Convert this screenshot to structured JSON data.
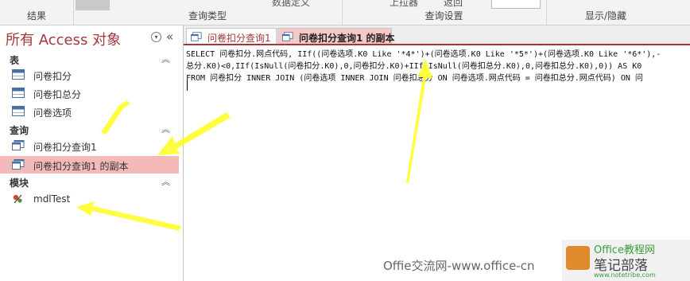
{
  "ribbon": {
    "groups": [
      "结果",
      "查询类型",
      "查询设置",
      "显示/隐藏"
    ],
    "cut_labels": [
      "数据定义",
      "上拉器",
      "返回"
    ]
  },
  "nav": {
    "title": "所有 Access 对象",
    "collapse": "«",
    "sections": [
      {
        "label": "表",
        "items": [
          "问卷扣分",
          "问卷扣总分",
          "问卷选项"
        ]
      },
      {
        "label": "查询",
        "items": [
          "问卷扣分查询1",
          "问卷扣分查询1 的副本"
        ]
      },
      {
        "label": "模块",
        "items": [
          "mdlTest"
        ]
      }
    ],
    "selected": "问卷扣分查询1 的副本"
  },
  "tabs": [
    "问卷扣分查询1",
    "问卷扣分查询1 的副本"
  ],
  "sql_lines": [
    "SELECT 问卷扣分.网点代码, IIf((问卷选项.K0 Like '*4*')+(问卷选项.K0 Like '*5*')+(问卷选项.K0 Like '*6*'),-",
    "总分.K0)<0,IIf(IsNull(问卷扣分.K0),0,问卷扣分.K0)+IIf(IsNull(问卷扣总分.K0),0,问卷扣总分.K0),0)) AS K0",
    "FROM 问卷扣分 INNER JOIN (问卷选项 INNER JOIN 问卷扣总分 ON 问卷选项.网点代码 = 问卷扣总分.网点代码) ON 问"
  ],
  "watermark": "Offie交流网-www.office-cn",
  "badge": {
    "line1": "Office教程网",
    "line2": "笔记部落",
    "line3": "www.notetribe.com"
  },
  "colors": {
    "accent": "#a4373a",
    "selected_bg": "#f4b9b9",
    "arrow": "#ffff33"
  }
}
